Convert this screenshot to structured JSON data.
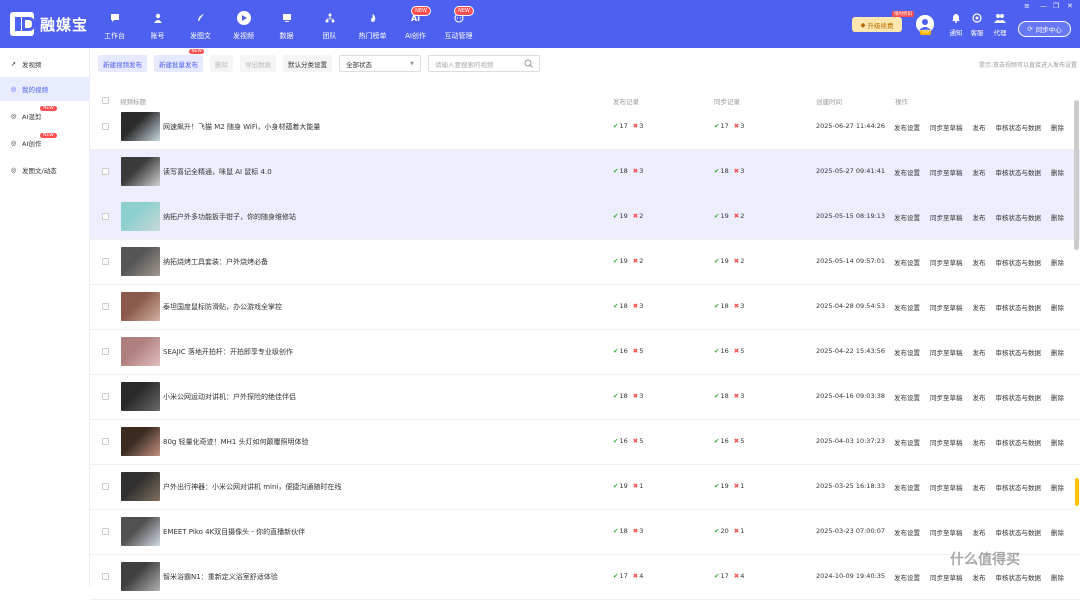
{
  "app": {
    "name": "融媒宝"
  },
  "nav": [
    {
      "label": "工作台",
      "icon": "chat-icon"
    },
    {
      "label": "账号",
      "icon": "user-icon"
    },
    {
      "label": "发图文",
      "icon": "feather-icon"
    },
    {
      "label": "发视频",
      "icon": "play-icon"
    },
    {
      "label": "数据",
      "icon": "data-icon"
    },
    {
      "label": "团队",
      "icon": "team-icon"
    },
    {
      "label": "热门榜单",
      "icon": "fire-icon"
    },
    {
      "label": "AI创作",
      "icon": "ai-icon",
      "badge": "NEW"
    },
    {
      "label": "互动管理",
      "icon": "message-icon",
      "badge": "NEW"
    }
  ],
  "header": {
    "upgrade": "升级续费",
    "upgrade_tag": "限时折扣",
    "vip": "VIP",
    "tools": [
      {
        "label": "通知"
      },
      {
        "label": "客服"
      },
      {
        "label": "代理"
      }
    ],
    "sync": "同步中心"
  },
  "sidebar": [
    {
      "label": "发视频",
      "icon": "send-icon"
    },
    {
      "label": "我的视频",
      "icon": "video-icon",
      "active": true
    },
    {
      "label": "AI混剪",
      "icon": "ai-mix-icon",
      "badge": "NEW"
    },
    {
      "label": "AI创作",
      "icon": "ai-create-icon",
      "badge": "NEW"
    },
    {
      "label": "发图文/动态",
      "icon": "image-text-icon"
    }
  ],
  "toolbar": {
    "new_video": "新建视频发布",
    "new_batch": "新建批量发布",
    "new_batch_badge": "NEW",
    "delete": "删除",
    "export": "导出数据",
    "default_category": "默认分类设置",
    "status_select": "全部状态",
    "search_placeholder": "请输入要搜索的视频",
    "tip": "提示:双击视频可以直接进入发布设置"
  },
  "table": {
    "headers": {
      "title": "视频标题",
      "publish": "发布记录",
      "sync": "同步记录",
      "created": "创建时间",
      "action": "操作"
    },
    "actions": [
      "发布设置",
      "同步至草稿",
      "发布",
      "审核状态与数据",
      "删除"
    ],
    "rows": [
      {
        "title": "网速飙升！飞猫 M2 随身 WiFi，小身材蕴着大能量",
        "pub_ok": "17",
        "pub_fail": "3",
        "sync_ok": "17",
        "sync_fail": "3",
        "date": "2025-06-27 11:44:26",
        "thumb": [
          "#2b2b2b",
          "#c8d8e0"
        ]
      },
      {
        "title": "读写喜记全精通，咪鼠 AI 鼠标 4.0",
        "pub_ok": "18",
        "pub_fail": "3",
        "sync_ok": "18",
        "sync_fail": "3",
        "date": "2025-05-27 09:41:41",
        "thumb": [
          "#3a3a3a",
          "#d0d0d0"
        ]
      },
      {
        "title": "纳拓户外多功能扳手钳子，你的随身维修站",
        "pub_ok": "19",
        "pub_fail": "2",
        "sync_ok": "19",
        "sync_fail": "2",
        "date": "2025-05-15 08:19:13",
        "thumb": [
          "#8ecfd0",
          "#c9d9d4"
        ]
      },
      {
        "title": "纳拓烧烤工具套装：户外烧烤必备",
        "pub_ok": "19",
        "pub_fail": "2",
        "sync_ok": "19",
        "sync_fail": "2",
        "date": "2025-05-14 09:57:01",
        "thumb": [
          "#555555",
          "#a09890"
        ]
      },
      {
        "title": "泰坦国度鼠标防滑贴，办公游戏全掌控",
        "pub_ok": "18",
        "pub_fail": "3",
        "sync_ok": "18",
        "sync_fail": "3",
        "date": "2025-04-28 09:54:53",
        "thumb": [
          "#8a5a4a",
          "#d0b0a0"
        ]
      },
      {
        "title": "SEAJIC 落地开拍杆：开拍即享专业级创作",
        "pub_ok": "16",
        "pub_fail": "5",
        "sync_ok": "16",
        "sync_fail": "5",
        "date": "2025-04-22 15:43:56",
        "thumb": [
          "#b08080",
          "#e0c0c0"
        ]
      },
      {
        "title": "小米公网运动对讲机：户外探险的绝佳伴侣",
        "pub_ok": "18",
        "pub_fail": "3",
        "sync_ok": "18",
        "sync_fail": "3",
        "date": "2025-04-16 09:03:38",
        "thumb": [
          "#2a2a2a",
          "#6a6a6a"
        ]
      },
      {
        "title": "80g 轻量化奇迹！MH1 头灯如何颠覆照明体验",
        "pub_ok": "16",
        "pub_fail": "5",
        "sync_ok": "16",
        "sync_fail": "5",
        "date": "2025-04-03 10:37:23",
        "thumb": [
          "#3a2a20",
          "#c09080"
        ]
      },
      {
        "title": "户外出行神器：小米公网对讲机 mini，便捷沟通随时在线",
        "pub_ok": "19",
        "pub_fail": "1",
        "sync_ok": "19",
        "sync_fail": "1",
        "date": "2025-03-25 16:18:33",
        "thumb": [
          "#303030",
          "#807060"
        ]
      },
      {
        "title": "EMEET Piko 4K双目摄像头 - 你的直播新伙伴",
        "pub_ok": "18",
        "pub_fail": "3",
        "sync_ok": "20",
        "sync_fail": "1",
        "date": "2025-03-23 07:00:07",
        "thumb": [
          "#505050",
          "#d0d8e0"
        ]
      },
      {
        "title": "智米浴霸N1：重新定义浴室舒适体验",
        "pub_ok": "17",
        "pub_fail": "4",
        "sync_ok": "17",
        "sync_fail": "4",
        "date": "2024-10-09 19:40:35",
        "thumb": [
          "#404040",
          "#b0b0b0"
        ]
      }
    ]
  },
  "watermark": "什么值得买",
  "colors": {
    "primary": "#4e60f0",
    "success": "#33aa33",
    "danger": "#ff4d4f",
    "highlight": "#ecedfd"
  }
}
